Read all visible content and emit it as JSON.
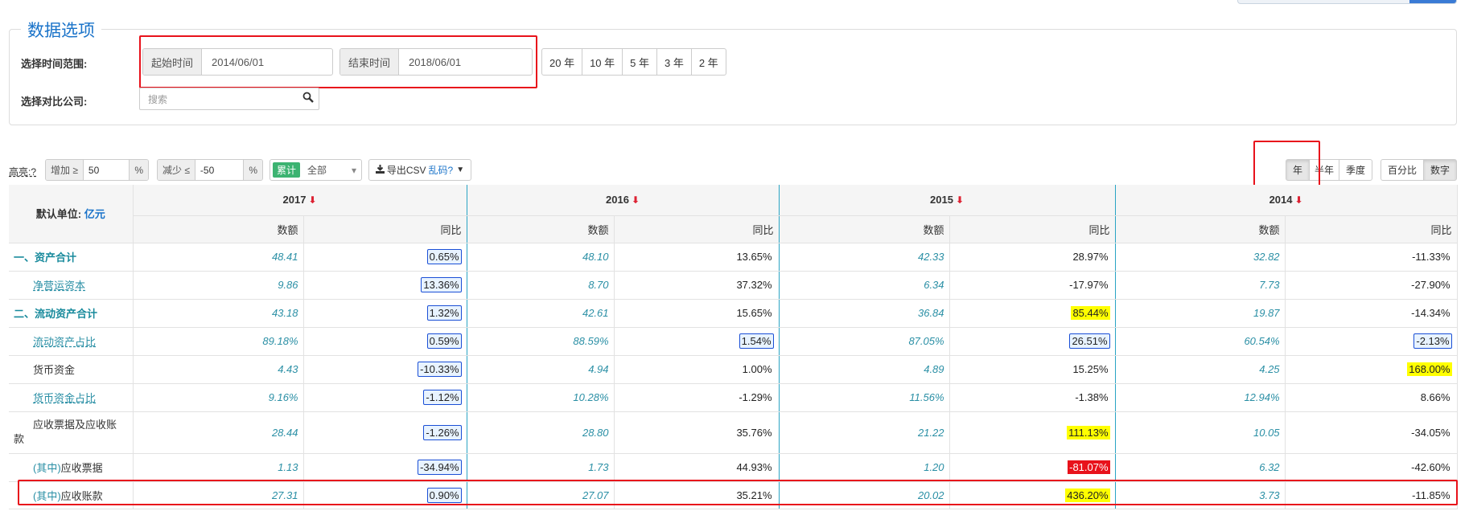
{
  "options": {
    "legend": "数据选项",
    "time_range_label": "选择时间范围:",
    "start_label": "起始时间",
    "start_value": "2014/06/01",
    "end_label": "结束时间",
    "end_value": "2018/06/01",
    "year_buttons": [
      "20 年",
      "10 年",
      "5 年",
      "3 年",
      "2 年"
    ],
    "compare_label": "选择对比公司:",
    "search_placeholder": "搜索"
  },
  "toolbar": {
    "highlight_label": "高亮:?",
    "increase_label": "增加 ≥",
    "increase_value": "50",
    "decrease_label": "减少 ≤",
    "decrease_value": "-50",
    "percent": "%",
    "cumulative": "累计",
    "all": "全部",
    "export": "导出CSV",
    "garbled": "乱码?",
    "period_buttons": [
      "年",
      "半年",
      "季度"
    ],
    "mode_buttons": [
      "百分比",
      "数字"
    ]
  },
  "table": {
    "unit_label": "默认单位:",
    "unit_value": "亿元",
    "years": [
      "2017",
      "2016",
      "2015",
      "2014"
    ],
    "amount_header": "数额",
    "yoy_header": "同比",
    "rows": [
      {
        "name": "一、资产合计",
        "style": "bold",
        "cells": [
          [
            "48.41",
            "0.65%",
            "box"
          ],
          [
            "48.10",
            "13.65%",
            ""
          ],
          [
            "42.33",
            "28.97%",
            ""
          ],
          [
            "32.82",
            "-11.33%",
            ""
          ]
        ]
      },
      {
        "name": "净营运资本",
        "style": "link",
        "cells": [
          [
            "9.86",
            "13.36%",
            "box"
          ],
          [
            "8.70",
            "37.32%",
            ""
          ],
          [
            "6.34",
            "-17.97%",
            ""
          ],
          [
            "7.73",
            "-27.90%",
            ""
          ]
        ]
      },
      {
        "name": "二、流动资产合计",
        "style": "bold",
        "cells": [
          [
            "43.18",
            "1.32%",
            "box"
          ],
          [
            "42.61",
            "15.65%",
            ""
          ],
          [
            "36.84",
            "85.44%",
            "yel"
          ],
          [
            "19.87",
            "-14.34%",
            ""
          ]
        ]
      },
      {
        "name": "流动资产占比",
        "style": "link",
        "cells": [
          [
            "89.18%",
            "0.59%",
            "box"
          ],
          [
            "88.59%",
            "1.54%",
            "box"
          ],
          [
            "87.05%",
            "26.51%",
            "box"
          ],
          [
            "60.54%",
            "-2.13%",
            "box"
          ]
        ]
      },
      {
        "name": "货币资金",
        "style": "plain",
        "cells": [
          [
            "4.43",
            "-10.33%",
            "box"
          ],
          [
            "4.94",
            "1.00%",
            ""
          ],
          [
            "4.89",
            "15.25%",
            ""
          ],
          [
            "4.25",
            "168.00%",
            "yel"
          ]
        ]
      },
      {
        "name": "货币资金占比",
        "style": "link",
        "cells": [
          [
            "9.16%",
            "-1.12%",
            "box"
          ],
          [
            "10.28%",
            "-1.29%",
            ""
          ],
          [
            "11.56%",
            "-1.38%",
            ""
          ],
          [
            "12.94%",
            "8.66%",
            ""
          ]
        ]
      },
      {
        "name": "应收票据及应收账",
        "name2": "款",
        "style": "plain",
        "cells": [
          [
            "28.44",
            "-1.26%",
            "box"
          ],
          [
            "28.80",
            "35.76%",
            ""
          ],
          [
            "21.22",
            "111.13%",
            "yel"
          ],
          [
            "10.05",
            "-34.05%",
            ""
          ]
        ]
      },
      {
        "prefix": "(其中)",
        "name": "应收票据",
        "style": "sub",
        "cells": [
          [
            "1.13",
            "-34.94%",
            "box"
          ],
          [
            "1.73",
            "44.93%",
            ""
          ],
          [
            "1.20",
            "-81.07%",
            "red"
          ],
          [
            "6.32",
            "-42.60%",
            ""
          ]
        ]
      },
      {
        "prefix": "(其中)",
        "name": "应收账款",
        "style": "sub",
        "cells": [
          [
            "27.31",
            "0.90%",
            "box"
          ],
          [
            "27.07",
            "35.21%",
            ""
          ],
          [
            "20.02",
            "436.20%",
            "yel"
          ],
          [
            "3.73",
            "-11.85%",
            ""
          ]
        ]
      }
    ]
  }
}
